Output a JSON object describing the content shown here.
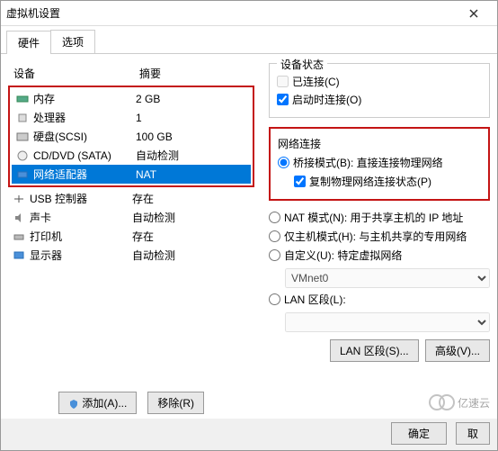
{
  "title": "虚拟机设置",
  "tabs": [
    "硬件",
    "选项"
  ],
  "active_tab": 0,
  "hw_header": {
    "device": "设备",
    "summary": "摘要"
  },
  "hw": [
    {
      "icon": "memory-icon",
      "name": "内存",
      "summary": "2 GB"
    },
    {
      "icon": "cpu-icon",
      "name": "处理器",
      "summary": "1"
    },
    {
      "icon": "disk-icon",
      "name": "硬盘(SCSI)",
      "summary": "100 GB"
    },
    {
      "icon": "cd-icon",
      "name": "CD/DVD (SATA)",
      "summary": "自动检测"
    },
    {
      "icon": "network-icon",
      "name": "网络适配器",
      "summary": "NAT",
      "selected": true
    },
    {
      "icon": "usb-icon",
      "name": "USB 控制器",
      "summary": "存在"
    },
    {
      "icon": "sound-icon",
      "name": "声卡",
      "summary": "自动检测"
    },
    {
      "icon": "printer-icon",
      "name": "打印机",
      "summary": "存在"
    },
    {
      "icon": "display-icon",
      "name": "显示器",
      "summary": "自动检测"
    }
  ],
  "add_btn": "添加(A)...",
  "remove_btn": "移除(R)",
  "device_status": {
    "legend": "设备状态",
    "connected": "已连接(C)",
    "connect_on": "启动时连接(O)"
  },
  "net": {
    "legend": "网络连接",
    "bridged": "桥接模式(B): 直接连接物理网络",
    "replicate": "复制物理网络连接状态(P)",
    "nat": "NAT 模式(N): 用于共享主机的 IP 地址",
    "hostonly": "仅主机模式(H): 与主机共享的专用网络",
    "custom": "自定义(U): 特定虚拟网络",
    "custom_val": "VMnet0",
    "lan": "LAN 区段(L):"
  },
  "lan_btn": "LAN 区段(S)...",
  "adv_btn": "高级(V)...",
  "ok": "确定",
  "cancel": "取",
  "watermark": "亿速云"
}
